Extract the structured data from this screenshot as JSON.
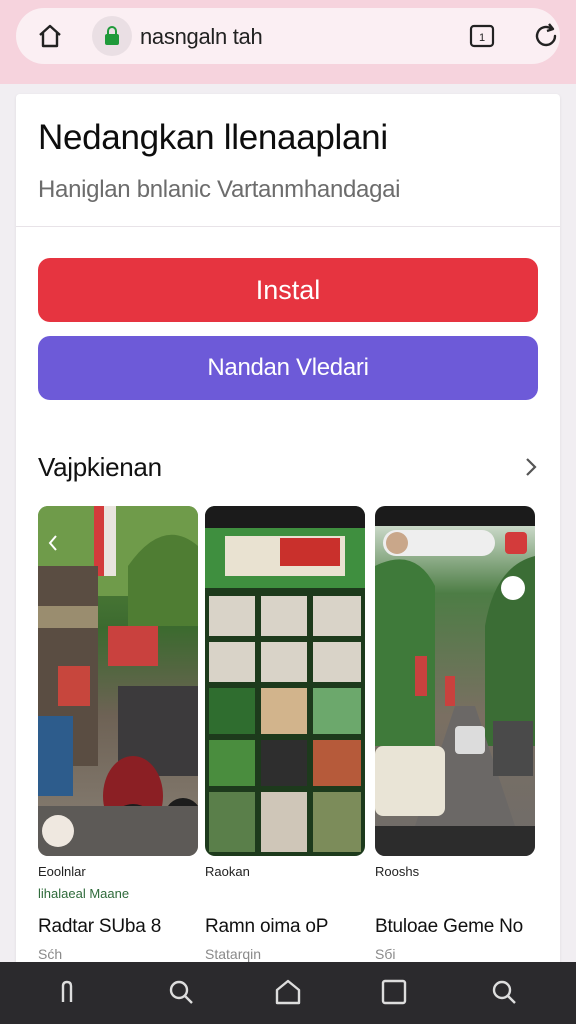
{
  "browser": {
    "url": "nasngaln tah",
    "icons": [
      "home-icon",
      "lock-icon",
      "tabs-icon",
      "reload-icon"
    ],
    "tab_count": "1"
  },
  "app": {
    "title": "Nedangkan llenaaplani",
    "subtitle": "Haniglan bnlanic Vartanmhandagai",
    "install_label": "Instal",
    "secondary_label": "Nandan Vledari",
    "install_color": "#e63440",
    "secondary_color": "#6d5ad8"
  },
  "section": {
    "title": "Vajpkienan"
  },
  "screenshots": [
    {
      "row1": "Eoolnlar",
      "row2": "lihalaeal Maane",
      "title": "Radtar SUba 8",
      "sub": "Sćh"
    },
    {
      "row1": "Raokan",
      "row2": "",
      "title": "Ramn oima oP",
      "sub": "Statarqin"
    },
    {
      "row1": "Rooshs",
      "row2": "",
      "title": "Btuloae Geme No",
      "sub": "Sбi"
    }
  ],
  "bottom_nav": [
    "back-icon",
    "search-icon",
    "home-icon",
    "recents-icon",
    "search-icon"
  ]
}
